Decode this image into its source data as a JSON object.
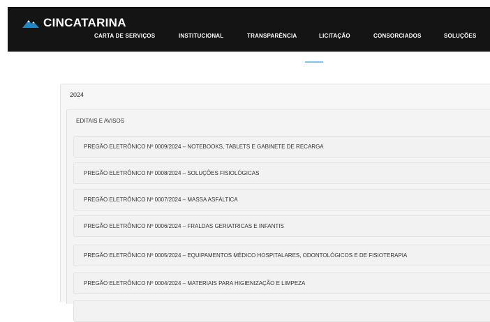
{
  "header": {
    "brand": "CINCATARINA",
    "logo_icon": "mountain-logo-icon",
    "brand_color": "#1e88c7",
    "menu": [
      {
        "label": "CARTA DE SERVIÇOS"
      },
      {
        "label": "INSTITUCIONAL"
      },
      {
        "label": "TRANSPARÊNCIA"
      },
      {
        "label": "LICITAÇÃO"
      },
      {
        "label": "CONSORCIADOS"
      },
      {
        "label": "SOLUÇÕES"
      }
    ]
  },
  "main": {
    "year": "2024",
    "section": "EDITAIS E AVISOS",
    "items": [
      {
        "label": "PREGÃO ELETRÔNICO Nº 0009/2024 – NOTEBOOKS, TABLETS E GABINETE DE RECARGA"
      },
      {
        "label": "PREGÃO ELETRÔNICO Nº 0008/2024 – SOLUÇÕES FISIOLÓGICAS"
      },
      {
        "label": "PREGÃO ELETRÔNICO Nº 0007/2024 – MASSA ASFÁLTICA"
      },
      {
        "label": "PREGÃO ELETRÔNICO Nº 0006/2024 – FRALDAS GERIATRICAS E INFANTIS"
      },
      {
        "label": "PREGÃO ELETRÔNICO Nº 0005/2024 – EQUIPAMENTOS MÉDICO HOSPITALARES, ODONTOLÓGICOS E DE FISIOTERAPIA"
      },
      {
        "label": "PREGÃO ELETRÔNICO Nº 0004/2024 – MATERIAIS PARA HIGIENIZAÇÃO E LIMPEZA"
      }
    ]
  }
}
